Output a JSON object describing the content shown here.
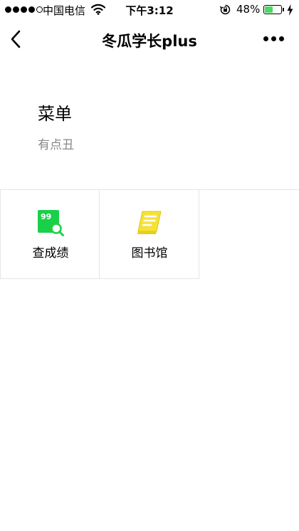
{
  "status_bar": {
    "carrier": "中国电信",
    "time": "下午3:12",
    "battery_percent": "48%",
    "battery_level": 0.48,
    "battery_color": "#4cd964"
  },
  "nav": {
    "title": "冬瓜学长plus",
    "back_icon": "chevron-left-icon",
    "more_icon": "ellipsis-icon"
  },
  "page": {
    "title": "菜单",
    "subtitle": "有点丑"
  },
  "menu": {
    "items": [
      {
        "label": "查成绩",
        "icon": "grade-search-icon",
        "icon_text": "99",
        "color": "#1ad04a"
      },
      {
        "label": "图书馆",
        "icon": "book-icon",
        "color": "#f4e23a"
      }
    ]
  }
}
